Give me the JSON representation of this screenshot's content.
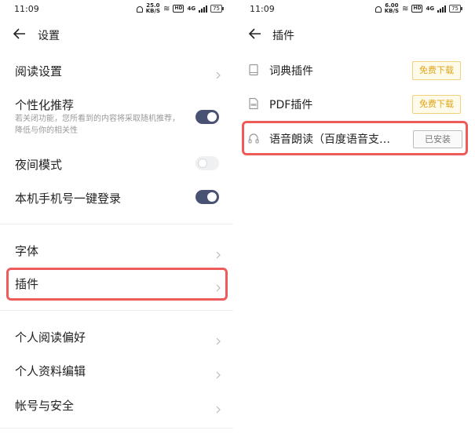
{
  "left": {
    "status": {
      "time": "11:09",
      "speed_value": "25.0",
      "speed_unit": "KB/S",
      "net_label": "4G",
      "battery": "75"
    },
    "header": {
      "title": "设置"
    },
    "rows": {
      "reading_settings": "阅读设置",
      "personalized": "个性化推荐",
      "personalized_sub": "若关闭功能，您所看到的内容将采取随机推荐，降低与你的相关性",
      "night_mode": "夜间模式",
      "one_click_login": "本机手机号一键登录",
      "font": "字体",
      "plugins": "插件",
      "reading_prefs": "个人阅读偏好",
      "profile_edit": "个人资料编辑",
      "account_security": "帐号与安全"
    },
    "toggles": {
      "personalized": "on",
      "night_mode": "off",
      "one_click_login": "on"
    }
  },
  "right": {
    "status": {
      "time": "11:09",
      "speed_value": "6.00",
      "speed_unit": "KB/S",
      "net_label": "4G",
      "battery": "75"
    },
    "header": {
      "title": "插件"
    },
    "plugins": [
      {
        "name": "词典插件",
        "action": "免费下载",
        "icon": "book-icon"
      },
      {
        "name": "PDF插件",
        "action": "免费下载",
        "icon": "pdf-icon"
      },
      {
        "name": "语音朗读（百度语音支…",
        "action": "已安装",
        "icon": "headphones-icon"
      }
    ]
  },
  "colors": {
    "toggle_on": "#4a5273",
    "highlight": "#ee5b5b",
    "free_button_text": "#e0a419",
    "free_button_border": "#f1d27a"
  }
}
